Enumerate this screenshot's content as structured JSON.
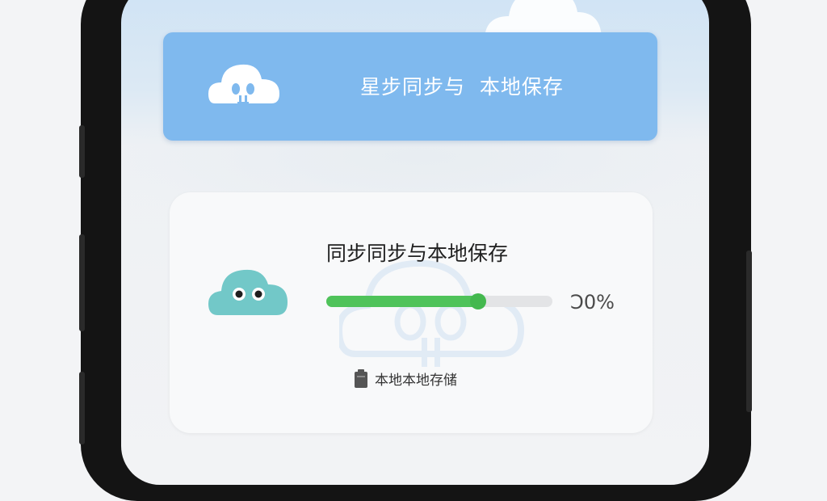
{
  "header": {
    "title": "星步同步与  本地保存",
    "icon": "cloud-robot-icon"
  },
  "card": {
    "title": "同步同步与本地保存",
    "mascot_icon": "cloud-mascot-icon",
    "progress": {
      "value_fraction": 0.67,
      "label": "Ɔ0%"
    },
    "storage": {
      "icon": "storage-card-icon",
      "label": "本地本地存储"
    }
  },
  "colors": {
    "banner": "#7fb9ee",
    "progress_fill": "#4fc35a",
    "mascot": "#72c8c8",
    "background": "#f3f4f6"
  }
}
